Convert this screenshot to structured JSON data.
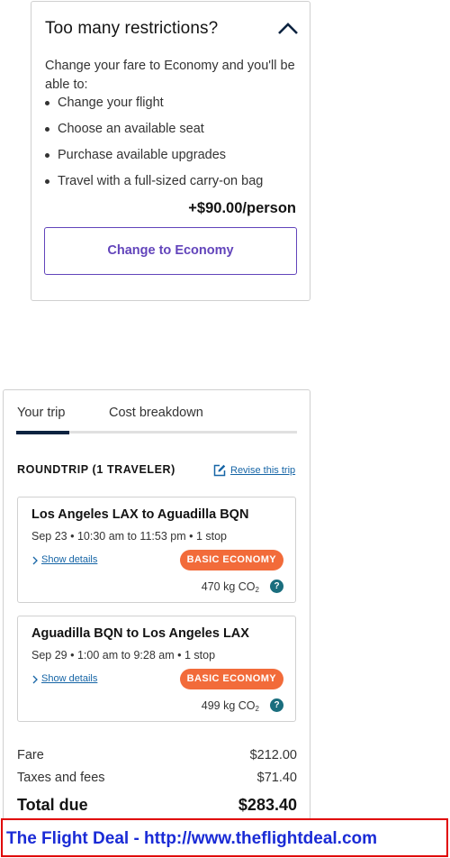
{
  "restrictions": {
    "title": "Too many restrictions?",
    "intro": "Change your fare to Economy and you'll be able to:",
    "benefits": [
      "Change your flight",
      "Choose an available seat",
      "Purchase available upgrades",
      "Travel with a full-sized carry-on bag"
    ],
    "price": "+$90.00/person",
    "button_label": "Change to Economy",
    "toggle_icon": "chevron-up-icon",
    "accent_color": "#6244bb"
  },
  "trip": {
    "tabs": [
      {
        "label": "Your trip",
        "active": true
      },
      {
        "label": "Cost breakdown",
        "active": false
      }
    ],
    "heading": "ROUNDTRIP (1 TRAVELER)",
    "revise_label": "Revise this trip",
    "segments": [
      {
        "route": "Los Angeles LAX to Aguadilla BQN",
        "times": "Sep 23 • 10:30 am to 11:53 pm • 1 stop",
        "details_label": "Show details",
        "fare_badge": "BASIC ECONOMY",
        "co2_value": "470 kg CO",
        "co2_sub": "2",
        "help": "?"
      },
      {
        "route": "Aguadilla BQN to Los Angeles LAX",
        "times": "Sep 29 • 1:00 am to 9:28 am • 1 stop",
        "details_label": "Show details",
        "fare_badge": "BASIC ECONOMY",
        "co2_value": "499 kg CO",
        "co2_sub": "2",
        "help": "?"
      }
    ],
    "costs": {
      "fare_label": "Fare",
      "fare_value": "$212.00",
      "taxes_label": "Taxes and fees",
      "taxes_value": "$71.40",
      "total_label": "Total due",
      "total_value": "$283.40"
    },
    "badge_color": "#f26b3a",
    "link_color": "#1665a6"
  },
  "banner": {
    "text": "The Flight Deal - http://www.theflightdeal.com",
    "text_color": "#1a2bd6",
    "border_color": "#e00000"
  }
}
